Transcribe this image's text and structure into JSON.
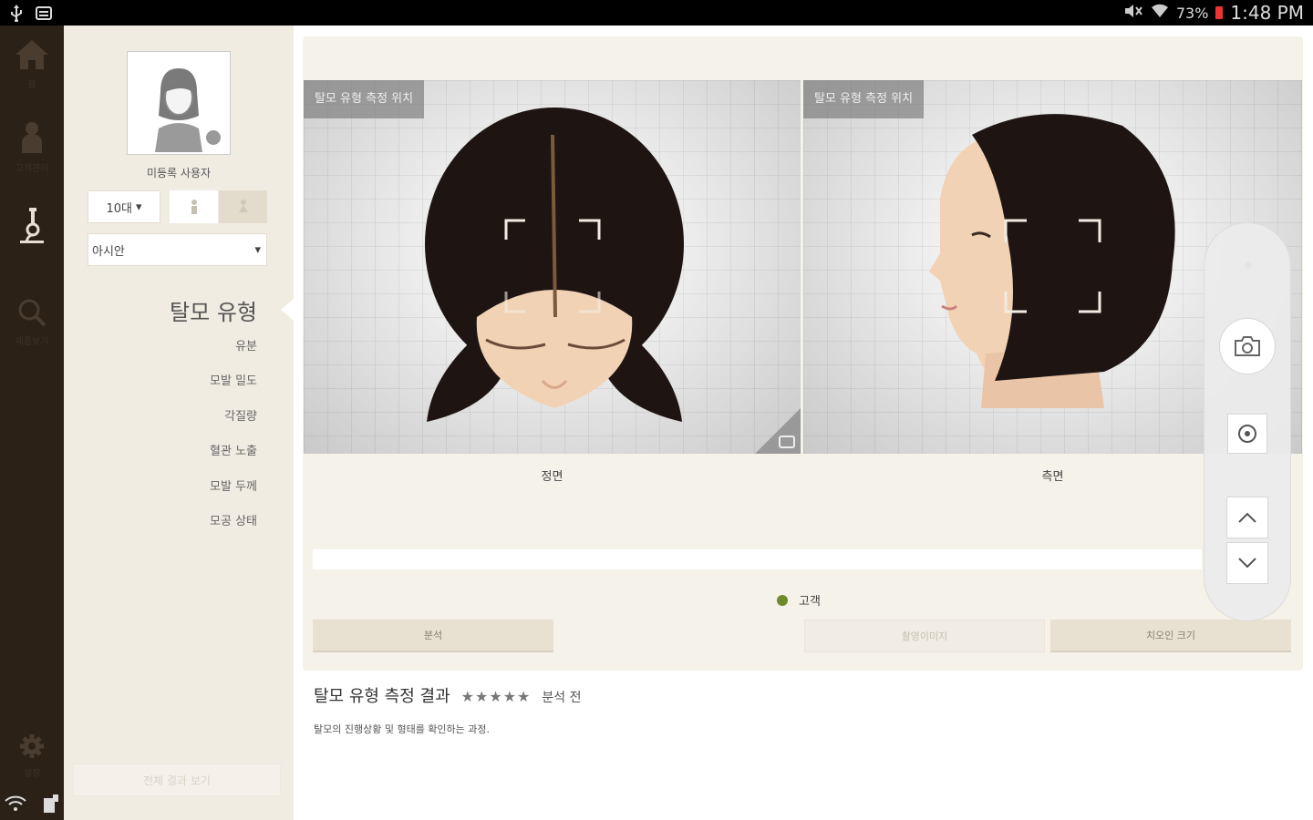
{
  "status_bar": {
    "battery": "73%",
    "time": "1:48 PM"
  },
  "rail": {
    "items": [
      {
        "label": "홈"
      },
      {
        "label": "고객관리"
      },
      {
        "label": ""
      },
      {
        "label": "제품보기"
      },
      {
        "label": "설정"
      }
    ]
  },
  "side": {
    "username": "미등록 사용자",
    "age": "10대",
    "race": "아시안",
    "menu_title": "탈모 유형",
    "menu_items": [
      "유분",
      "모발 밀도",
      "각질량",
      "혈관 노출",
      "모발 두께",
      "모공 상태"
    ],
    "view_all": "전체 결과 보기"
  },
  "panels": {
    "tag": "탈모 유형 측정 위치",
    "front_label": "정면",
    "side_label": "측면"
  },
  "legend": {
    "label": "고객"
  },
  "buttons": {
    "analyze": "분석",
    "capture": "촬영이미지",
    "zoom": "치오인 크기"
  },
  "result": {
    "title": "탈모 유형 측정 결과",
    "stars": "★★★★★",
    "status": "분석 전",
    "description": "탈모의 진행상황 및 형태를 확인하는 과정."
  },
  "colors": {
    "rail_bg": "#2b2117",
    "side_bg": "#f1ece2",
    "card_bg": "#f5f2ea",
    "button_bg": "#e8e0d0",
    "legend_dot": "#6e8a2a"
  }
}
